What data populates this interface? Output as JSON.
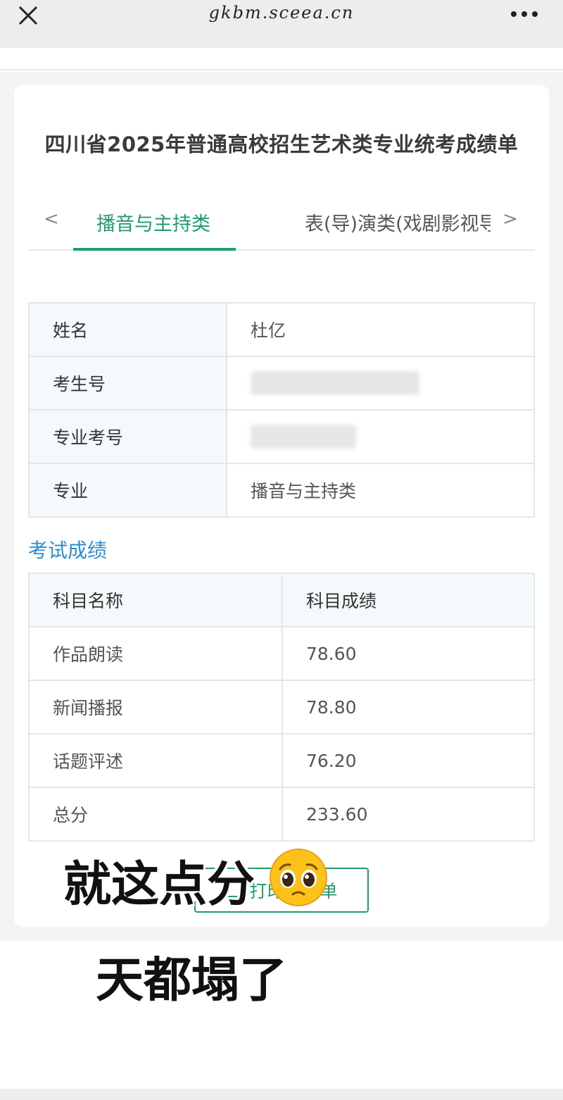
{
  "browser": {
    "url": "gkbm.sceea.cn"
  },
  "page": {
    "title": "四川省2025年普通高校招生艺术类专业统考成绩单"
  },
  "tabs": {
    "prev_arrow": "<",
    "next_arrow": ">",
    "items": [
      {
        "label": "播音与主持类",
        "active": true
      },
      {
        "label": "表(导)演类(戏剧影视导演)",
        "active": false
      }
    ]
  },
  "info": {
    "rows": [
      {
        "label": "姓名",
        "value": "杜亿"
      },
      {
        "label": "考生号",
        "value": ""
      },
      {
        "label": "专业考号",
        "value": ""
      },
      {
        "label": "专业",
        "value": "播音与主持类"
      }
    ]
  },
  "scores": {
    "section_title": "考试成绩",
    "headers": [
      "科目名称",
      "科目成绩"
    ],
    "rows": [
      {
        "subject": "作品朗读",
        "score": "78.60"
      },
      {
        "subject": "新闻播报",
        "score": "78.80"
      },
      {
        "subject": "话题评述",
        "score": "76.20"
      },
      {
        "subject": "总分",
        "score": "233.60"
      }
    ]
  },
  "print_button": {
    "label": "打印成绩单"
  },
  "overlay": {
    "caption_1": "就这点分",
    "caption_2": "天都塌了",
    "emoji": "pleading-face-emoji"
  },
  "colors": {
    "accent_green": "#1f9b6d",
    "section_blue": "#2a8cd6",
    "label_cell_bg": "#f4fafb"
  }
}
